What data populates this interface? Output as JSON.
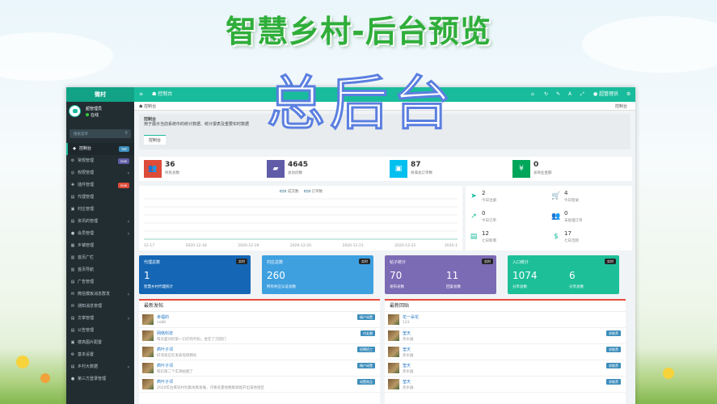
{
  "banner": {
    "title": "智慧乡村-后台预览"
  },
  "overlay": {
    "text": "总后台"
  },
  "topbar": {
    "logo": "微村",
    "hamburger": "≡",
    "tab": "控制台",
    "user": "超管理员"
  },
  "sidebar": {
    "user_name": "超管理员",
    "status": "在线",
    "search_placeholder": "搜索菜单",
    "items": [
      {
        "label": "控制台",
        "icon": "◆",
        "badge": "hot",
        "badge_color": "#3c8dbc",
        "active": true
      },
      {
        "label": "常规管理",
        "icon": "⚙",
        "badge": "new",
        "badge_color": "#605ca8"
      },
      {
        "label": "权限管理",
        "icon": "◎",
        "badge": "",
        "arrow": "‹"
      },
      {
        "label": "插件管理",
        "icon": "✚",
        "badge": "new",
        "badge_color": "#dd4b39"
      },
      {
        "label": "代理管理",
        "icon": "▤"
      },
      {
        "label": "村庄管理",
        "icon": "▣"
      },
      {
        "label": "资讯的管理",
        "icon": "▤",
        "arrow": "‹"
      },
      {
        "label": "会员管理",
        "icon": "●",
        "arrow": "‹"
      },
      {
        "label": "乡镇管理",
        "icon": "▦"
      },
      {
        "label": "首页广栏",
        "icon": "▥"
      },
      {
        "label": "首页导航",
        "icon": "▥"
      },
      {
        "label": "广告管理",
        "icon": "▤"
      },
      {
        "label": "微信模板消息群发",
        "icon": "✉",
        "arrow": "‹"
      },
      {
        "label": "通知消息管理",
        "icon": "✉"
      },
      {
        "label": "文章管理",
        "icon": "▤",
        "arrow": "‹"
      },
      {
        "label": "公告管理",
        "icon": "▤"
      },
      {
        "label": "楼高图片配置",
        "icon": "▣"
      },
      {
        "label": "基本设置",
        "icon": "⚙"
      },
      {
        "label": "乡村大数据",
        "icon": "▤",
        "arrow": "‹"
      },
      {
        "label": "第三方登录管理",
        "icon": "●"
      }
    ]
  },
  "main": {
    "tab": "控制台",
    "breadcrumb": "控制台",
    "header_title": "控制台",
    "header_desc": "用于展示当前系统中的统计数据、统计报表及重要实时数据",
    "header_tab": "控制台"
  },
  "stats": [
    {
      "value": "36",
      "label": "村民总数",
      "color": "#dd4b39",
      "icon": "👥"
    },
    {
      "value": "4645",
      "label": "总访问数",
      "color": "#605ca8",
      "icon": "▰"
    },
    {
      "value": "87",
      "label": "商城总订单数",
      "color": "#00c0ef",
      "icon": "▣"
    },
    {
      "value": "0",
      "label": "总商业金额",
      "color": "#00a65a",
      "icon": "¥"
    }
  ],
  "chart_data": {
    "type": "line",
    "categories": [
      "12-17",
      "2020-12-18",
      "2020-12-19",
      "2020-12-20",
      "2020-12-21",
      "2020-12-22",
      "2020-1"
    ],
    "series": [
      {
        "name": "成交数",
        "values": [
          0,
          0,
          0,
          0,
          0,
          0,
          0
        ]
      },
      {
        "name": "订单数",
        "values": [
          0,
          0,
          0,
          0,
          0,
          0,
          0
        ]
      }
    ]
  },
  "mini_stats": [
    {
      "value": "2",
      "label": "今日注册",
      "icon": "➤"
    },
    {
      "value": "4",
      "label": "今日登录",
      "icon": "🛒"
    },
    {
      "value": "0",
      "label": "今日订单",
      "icon": "↗"
    },
    {
      "value": "0",
      "label": "未处理订单",
      "icon": "👥"
    },
    {
      "value": "12",
      "label": "七日新增",
      "icon": "▤"
    },
    {
      "value": "17",
      "label": "七日活跃",
      "icon": "$"
    }
  ],
  "cards": [
    {
      "title": "代理总数",
      "tag": "实时",
      "value": "1",
      "sub": "智慧乡村代理统计",
      "color": "#1567b5"
    },
    {
      "title": "村庄总数",
      "tag": "实时",
      "value": "260",
      "sub": "所有村庄认证总数",
      "color": "#3fa0e0"
    },
    {
      "title": "帖子统计",
      "tag": "实时",
      "value": "70",
      "value2": "11",
      "sub": "发布总数",
      "sub2": "回复总数",
      "color": "#7b6bb5"
    },
    {
      "title": "入口统计",
      "tag": "实时",
      "value": "1074",
      "value2": "6",
      "sub": "分享总数",
      "sub2": "分享总数",
      "color": "#1dbf99"
    }
  ],
  "posts": {
    "title": "最新发帖",
    "items": [
      {
        "name": "幸福的",
        "text": "ce88",
        "tag": "精户闲置",
        "tag_color": "#3c8dbc"
      },
      {
        "name": "网络科技",
        "text": "每天面对的第一口打的代码，坐在了沉寂们",
        "tag": "村友圈",
        "tag_color": "#3c8dbc"
      },
      {
        "name": "疯叶子邻",
        "text": "好消息应在发表现很精彩",
        "tag": "招聘招工",
        "tag_color": "#3c8dbc"
      },
      {
        "name": "疯叶子邻",
        "text": "和幻第二个实测帖图了",
        "tag": "精户闲置",
        "tag_color": "#3c8dbc"
      },
      {
        "name": "疯叶子邻",
        "text": "2020年古库农村包集地库发展，汗要名量地晚联调观开出道地组区",
        "tag": "闲置商品",
        "tag_color": "#3c8dbc"
      }
    ]
  },
  "replies": {
    "title": "最新回贴",
    "items": [
      {
        "name": "花一朵花",
        "text": "123",
        "tag": ""
      },
      {
        "name": "莹天",
        "text": "热水器",
        "tag": "求推荐",
        "tag_color": "#3c8dbc"
      },
      {
        "name": "莹天",
        "text": "热水器",
        "tag": "求推荐",
        "tag_color": "#3c8dbc"
      },
      {
        "name": "莹天",
        "text": "热水器",
        "tag": "求推荐",
        "tag_color": "#3c8dbc"
      },
      {
        "name": "莹天",
        "text": "热水器",
        "tag": "求推荐",
        "tag_color": "#3c8dbc"
      }
    ]
  }
}
